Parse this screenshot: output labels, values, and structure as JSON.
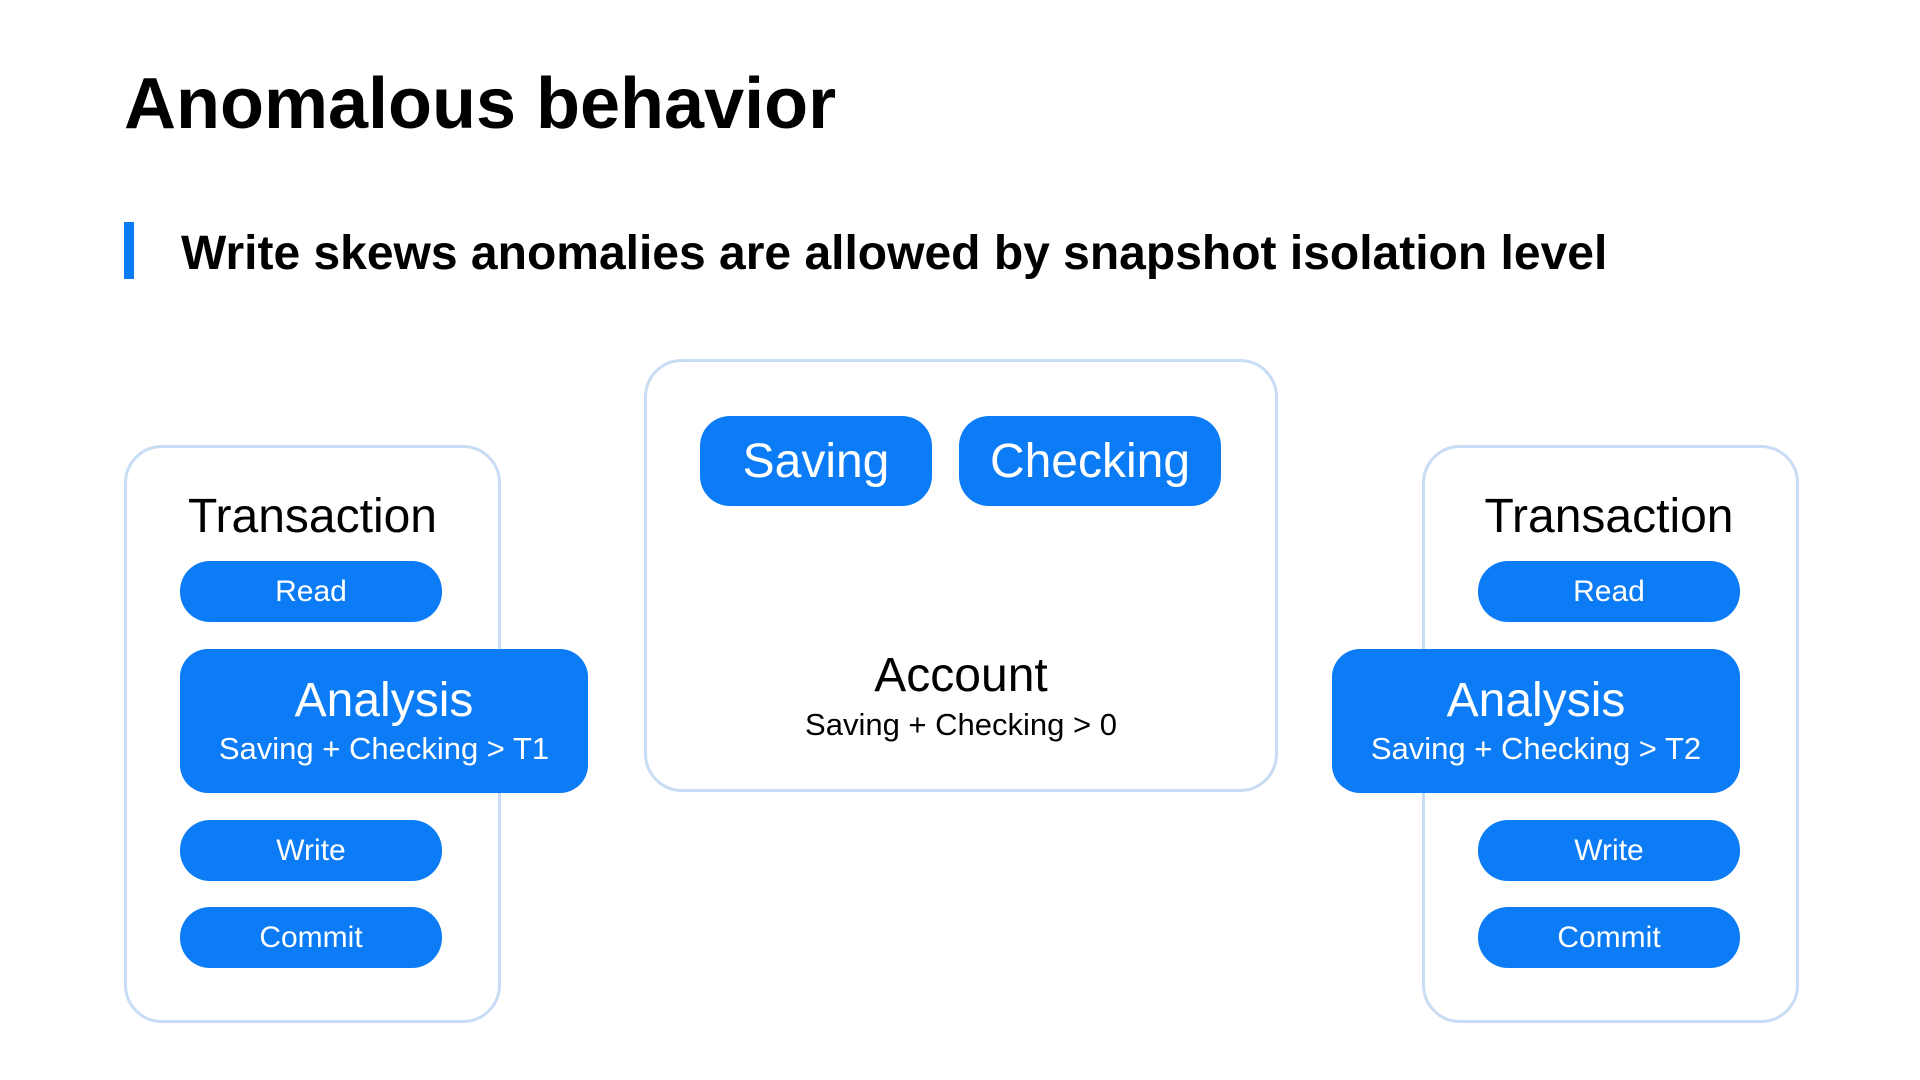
{
  "slide": {
    "title": "Anomalous behavior",
    "subtitle": "Write skews anomalies are allowed by snapshot isolation level"
  },
  "colors": {
    "accent": "#0B7CF6",
    "panel_border": "#C8DCF4",
    "text": "#000000",
    "pill_text": "#FFFFFF"
  },
  "transaction_left": {
    "label": "Transaction",
    "steps": [
      "Read",
      "Write",
      "Commit"
    ],
    "analysis": {
      "title": "Analysis",
      "condition": "Saving + Checking > T1"
    }
  },
  "account": {
    "fields": [
      "Saving",
      "Checking"
    ],
    "title": "Account",
    "constraint": "Saving + Checking > 0"
  },
  "transaction_right": {
    "label": "Transaction",
    "steps": [
      "Read",
      "Write",
      "Commit"
    ],
    "analysis": {
      "title": "Analysis",
      "condition": "Saving + Checking > T2"
    }
  }
}
